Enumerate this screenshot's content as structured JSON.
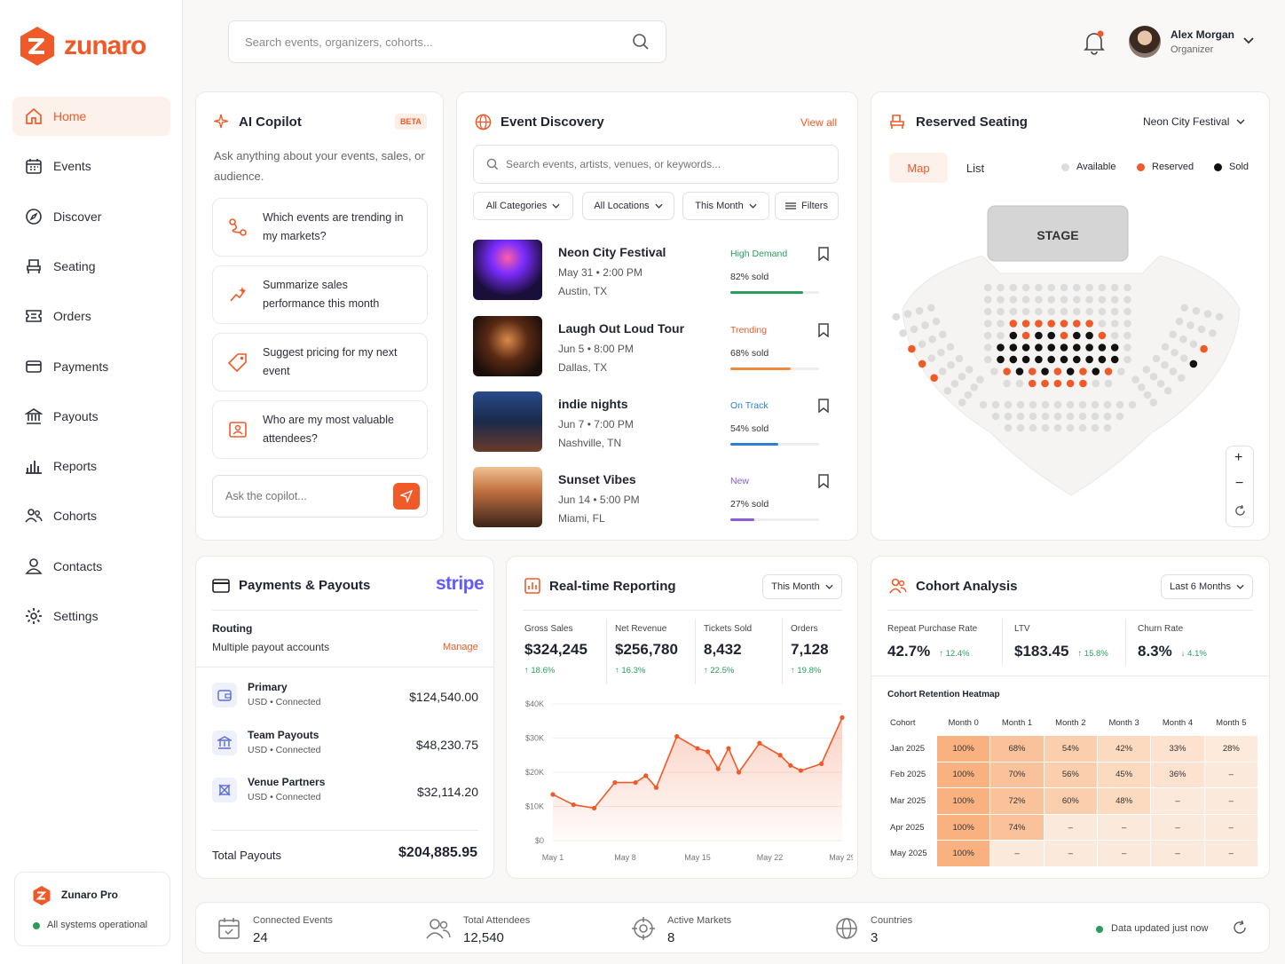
{
  "brand": {
    "name": "zunaro",
    "pro_title": "Zunaro Pro",
    "status": "All systems operational"
  },
  "nav": [
    {
      "label": "Home",
      "icon": "home-icon"
    },
    {
      "label": "Events",
      "icon": "calendar-icon"
    },
    {
      "label": "Discover",
      "icon": "compass-icon"
    },
    {
      "label": "Seating",
      "icon": "seat-icon"
    },
    {
      "label": "Orders",
      "icon": "ticket-icon"
    },
    {
      "label": "Payments",
      "icon": "card-icon"
    },
    {
      "label": "Payouts",
      "icon": "bank-icon"
    },
    {
      "label": "Reports",
      "icon": "bar-chart-icon"
    },
    {
      "label": "Cohorts",
      "icon": "users-icon"
    },
    {
      "label": "Contacts",
      "icon": "user-icon"
    },
    {
      "label": "Settings",
      "icon": "gear-icon"
    }
  ],
  "header": {
    "search_placeholder": "Search events, organizers, cohorts...",
    "user_name": "Alex Morgan",
    "user_role": "Organizer"
  },
  "copilot": {
    "title": "AI Copilot",
    "badge": "BETA",
    "subtitle": "Ask anything about your events, sales, or audience.",
    "suggestions": [
      "Which events are trending in my markets?",
      "Summarize sales performance this month",
      "Suggest pricing for my next event",
      "Who are my most valuable attendees?"
    ],
    "input_placeholder": "Ask the copilot..."
  },
  "discovery": {
    "title": "Event Discovery",
    "view_all": "View all",
    "search_placeholder": "Search events, artists, venues, or keywords...",
    "filters": [
      "All Categories",
      "All Locations",
      "This Month",
      "Filters"
    ],
    "events": [
      {
        "name": "Neon City Festival",
        "date": "May 31 • 2:00 PM",
        "location": "Austin, TX",
        "tag": "High Demand",
        "tag_color": "#2a9d5c",
        "sold": "82% sold",
        "pct": 82,
        "bar_color": "#2a9d5c"
      },
      {
        "name": "Laugh Out Loud Tour",
        "date": "Jun 5 • 8:00 PM",
        "location": "Dallas, TX",
        "tag": "Trending",
        "tag_color": "#f05a28",
        "sold": "68% sold",
        "pct": 68,
        "bar_color": "#f08a3c"
      },
      {
        "name": "indie nights",
        "date": "Jun 7 • 7:00 PM",
        "location": "Nashville, TN",
        "tag": "On Track",
        "tag_color": "#2f7fd1",
        "sold": "54% sold",
        "pct": 54,
        "bar_color": "#2f7fd1"
      },
      {
        "name": "Sunset Vibes",
        "date": "Jun 14 • 5:00 PM",
        "location": "Miami, FL",
        "tag": "New",
        "tag_color": "#8a5cd6",
        "sold": "27% sold",
        "pct": 27,
        "bar_color": "#8a5cd6"
      }
    ]
  },
  "seating": {
    "title": "Reserved Seating",
    "event_select": "Neon City Festival",
    "tabs": [
      "Map",
      "List"
    ],
    "legend": [
      "Available",
      "Reserved",
      "Sold"
    ],
    "stage": "STAGE",
    "colors": {
      "available": "#dcdcdc",
      "reserved": "#f05a28",
      "sold": "#111111"
    }
  },
  "payments": {
    "title": "Payments & Payouts",
    "provider": "stripe",
    "routing_label": "Routing",
    "routing_sub": "Multiple payout accounts",
    "manage": "Manage",
    "accounts": [
      {
        "name": "Primary",
        "sub": "USD • Connected",
        "amount": "$124,540.00"
      },
      {
        "name": "Team Payouts",
        "sub": "USD • Connected",
        "amount": "$48,230.75"
      },
      {
        "name": "Venue Partners",
        "sub": "USD • Connected",
        "amount": "$32,114.20"
      }
    ],
    "total_label": "Total Payouts",
    "total": "$204,885.95"
  },
  "reporting": {
    "title": "Real-time Reporting",
    "period": "This Month",
    "kpis": [
      {
        "label": "Gross Sales",
        "value": "$324,245",
        "delta": "18.6%"
      },
      {
        "label": "Net Revenue",
        "value": "$256,780",
        "delta": "16.3%"
      },
      {
        "label": "Tickets Sold",
        "value": "8,432",
        "delta": "22.5%"
      },
      {
        "label": "Orders",
        "value": "7,128",
        "delta": "19.8%"
      }
    ]
  },
  "chart_data": {
    "type": "area",
    "y_ticks": [
      "$40K",
      "$30K",
      "$20K",
      "$10K",
      "$0"
    ],
    "x_ticks": [
      "May 1",
      "May 8",
      "May 15",
      "May 22",
      "May 29"
    ],
    "ylim": [
      0,
      40000
    ],
    "x": [
      1,
      3,
      5,
      7,
      9,
      10,
      11,
      13,
      15,
      16,
      17,
      18,
      19,
      21,
      23,
      24,
      25,
      27,
      29
    ],
    "values": [
      13500,
      10500,
      9500,
      17000,
      17000,
      19000,
      15500,
      30500,
      27000,
      26000,
      21000,
      27000,
      20000,
      28500,
      25000,
      22000,
      20500,
      22500,
      36000
    ]
  },
  "cohort": {
    "title": "Cohort Analysis",
    "period": "Last 6 Months",
    "kpis": [
      {
        "label": "Repeat Purchase Rate",
        "value": "42.7%",
        "delta": "12.4%",
        "dir": "up"
      },
      {
        "label": "LTV",
        "value": "$183.45",
        "delta": "15.8%",
        "dir": "up"
      },
      {
        "label": "Churn Rate",
        "value": "8.3%",
        "delta": "4.1%",
        "dir": "down"
      }
    ],
    "heatmap_title": "Cohort Retention Heatmap",
    "columns": [
      "Cohort",
      "Month 0",
      "Month 1",
      "Month 2",
      "Month 3",
      "Month 4",
      "Month 5"
    ],
    "rows": [
      [
        "Jan 2025",
        "100%",
        "68%",
        "54%",
        "42%",
        "33%",
        "28%"
      ],
      [
        "Feb 2025",
        "100%",
        "70%",
        "56%",
        "45%",
        "36%",
        "–"
      ],
      [
        "Mar 2025",
        "100%",
        "72%",
        "60%",
        "48%",
        "–",
        "–"
      ],
      [
        "Apr 2025",
        "100%",
        "74%",
        "–",
        "–",
        "–",
        "–"
      ],
      [
        "May 2025",
        "100%",
        "–",
        "–",
        "–",
        "–",
        "–"
      ]
    ]
  },
  "footer": {
    "stats": [
      {
        "label": "Connected Events",
        "value": "24"
      },
      {
        "label": "Total Attendees",
        "value": "12,540"
      },
      {
        "label": "Active Markets",
        "value": "8"
      },
      {
        "label": "Countries",
        "value": "3"
      }
    ],
    "updated": "Data updated just now"
  }
}
